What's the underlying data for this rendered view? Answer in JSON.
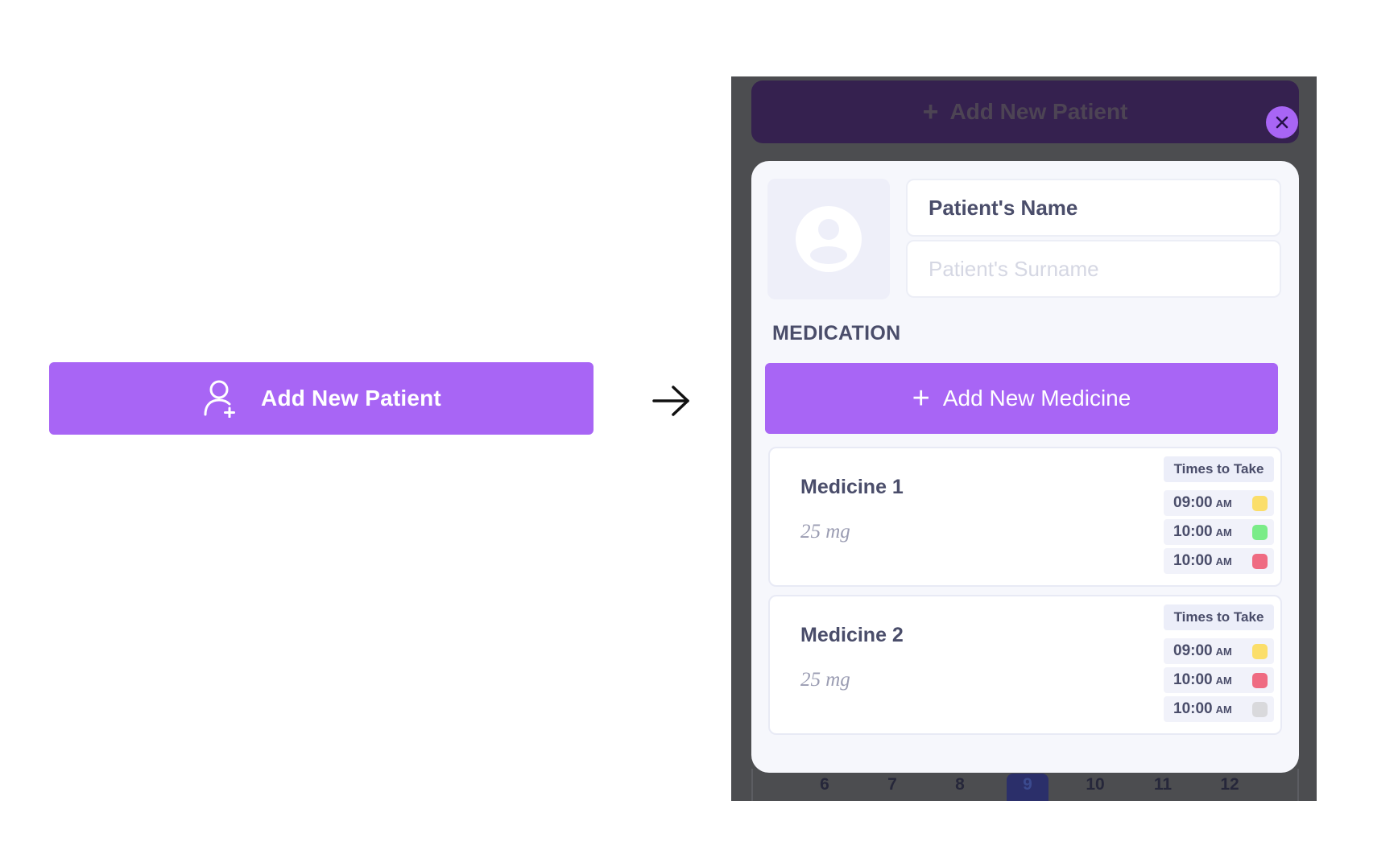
{
  "left_button": {
    "label": "Add New Patient",
    "icon": "add-user-icon",
    "color": "#a865f5"
  },
  "arrow": {
    "icon": "arrow-right-icon"
  },
  "phone": {
    "top_bar": {
      "label": "Add New Patient",
      "icon": "plus-icon"
    },
    "close": {
      "icon": "close-icon"
    },
    "calendar_days": [
      "6",
      "7",
      "8",
      "9",
      "10",
      "11",
      "12"
    ],
    "active_day": "9",
    "modal": {
      "name_value": "Patient's Name",
      "surname_placeholder": "Patient's Surname",
      "section_title": "MEDICATION",
      "add_medicine_label": "Add New Medicine",
      "medicines": [
        {
          "name": "Medicine 1",
          "dose": "25 mg",
          "times_header": "Times to Take",
          "times": [
            {
              "time": "09:00",
              "ampm": "AM",
              "color": "#fbde6a"
            },
            {
              "time": "10:00",
              "ampm": "AM",
              "color": "#7aec88"
            },
            {
              "time": "10:00",
              "ampm": "AM",
              "color": "#ef6b82"
            }
          ]
        },
        {
          "name": "Medicine 2",
          "dose": "25 mg",
          "times_header": "Times to Take",
          "times": [
            {
              "time": "09:00",
              "ampm": "AM",
              "color": "#fbde6a"
            },
            {
              "time": "10:00",
              "ampm": "AM",
              "color": "#ef6b82"
            },
            {
              "time": "10:00",
              "ampm": "AM",
              "color": "#d9d9dc"
            }
          ]
        }
      ]
    }
  }
}
